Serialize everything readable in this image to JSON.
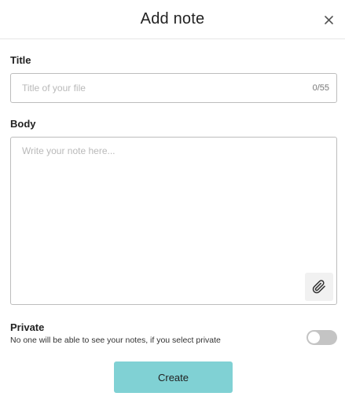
{
  "header": {
    "title": "Add note",
    "close_icon": "close-icon"
  },
  "title_field": {
    "label": "Title",
    "placeholder": "Title of your file",
    "value": "",
    "char_count": "0/55"
  },
  "body_field": {
    "label": "Body",
    "placeholder": "Write your note here...",
    "value": "",
    "attach_icon": "paperclip-icon"
  },
  "privacy": {
    "label": "Private",
    "description": "No one will be able to see your notes, if you select private",
    "enabled": false
  },
  "actions": {
    "create_label": "Create"
  },
  "colors": {
    "primary_button": "#80d1d4",
    "toggle_off": "#c4c4c4",
    "border": "#bdbdbd",
    "placeholder": "#b9b9b9"
  }
}
